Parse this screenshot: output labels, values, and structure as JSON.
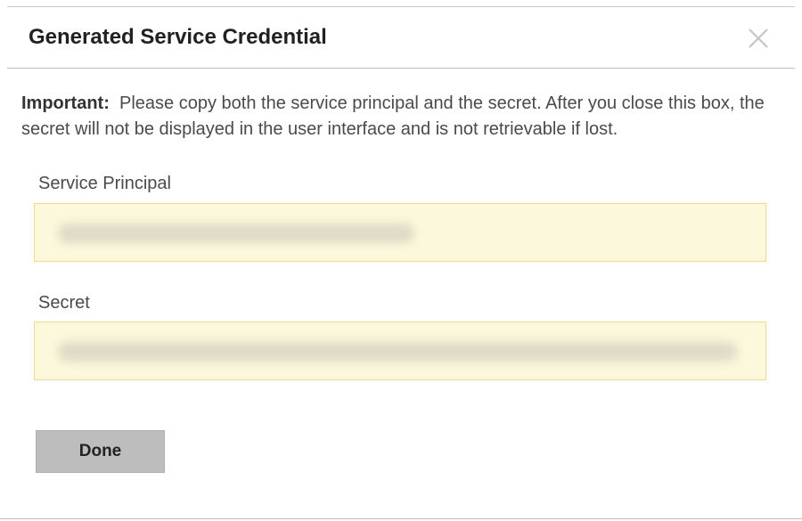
{
  "dialog": {
    "title": "Generated Service Credential",
    "close_icon": "close-icon",
    "message": {
      "strong": "Important:",
      "text": "Please copy both the service principal and the secret. After you close this box, the secret will not be displayed in the user interface and is not retrievable if lost."
    },
    "fields": {
      "service_principal": {
        "label": "Service Principal",
        "value_state": "redacted"
      },
      "secret": {
        "label": "Secret",
        "value_state": "redacted"
      }
    },
    "done_label": "Done"
  },
  "colors": {
    "field_background": "#fcf8dc",
    "field_border": "#f3d98f",
    "button_background": "#bdbdbd",
    "title_text": "#212121",
    "body_text": "#4a4a4a"
  }
}
